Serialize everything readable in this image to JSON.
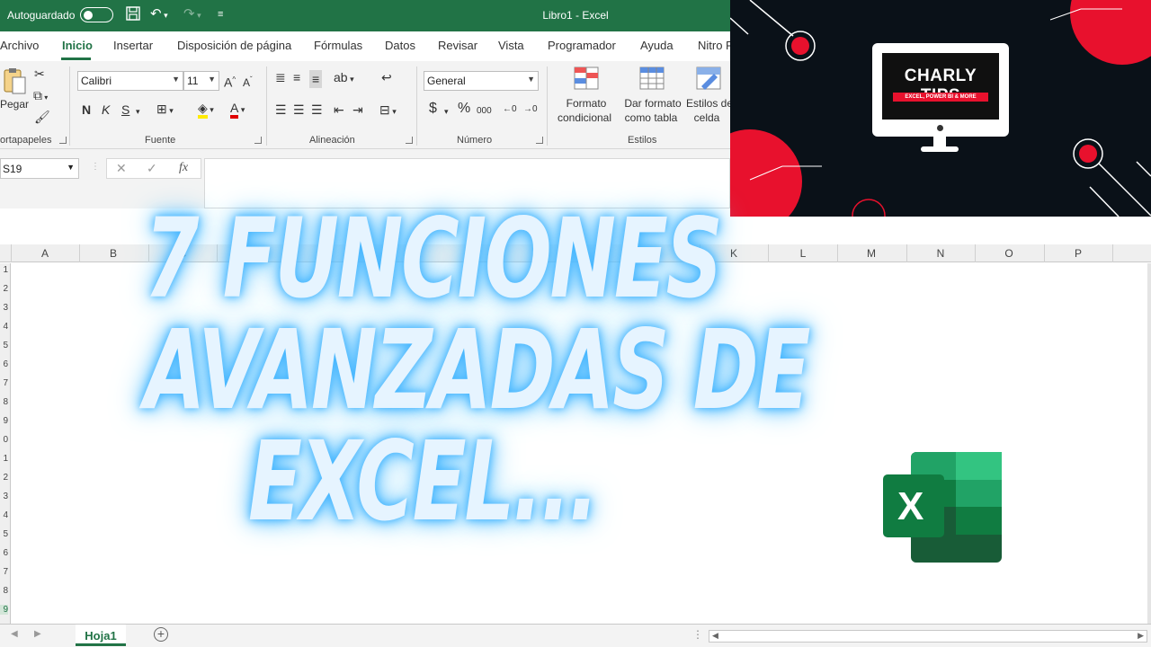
{
  "titlebar": {
    "autosave_label": "Autoguardado",
    "window_title": "Libro1  -  Excel",
    "save_icon": "save-icon",
    "undo_icon": "undo-icon",
    "redo_icon": "redo-icon",
    "customize_icon": "customize-qat-icon"
  },
  "tabs": [
    "Archivo",
    "Inicio",
    "Insertar",
    "Disposición de página",
    "Fórmulas",
    "Datos",
    "Revisar",
    "Vista",
    "Programador",
    "Ayuda",
    "Nitro P"
  ],
  "ribbon": {
    "clipboard": {
      "paste_label": "Pegar",
      "group_label": "ortapapeles"
    },
    "font": {
      "name": "Calibri",
      "size": "11",
      "bold": "N",
      "italic": "K",
      "underline": "S",
      "group_label": "Fuente"
    },
    "alignment": {
      "group_label": "Alineación"
    },
    "number": {
      "format": "General",
      "currency": "$",
      "percent": "%",
      "thousands": "000",
      "group_label": "Número"
    },
    "styles": {
      "conditional_line1": "Formato",
      "conditional_line2": "condicional",
      "table_line1": "Dar formato",
      "table_line2": "como tabla",
      "cell_line1": "Estilos de",
      "cell_line2": "celda",
      "group_label": "Estilos"
    }
  },
  "formula_bar": {
    "name_box": "S19",
    "fx": "fx"
  },
  "columns": [
    "A",
    "B",
    "C",
    "K",
    "L",
    "M",
    "N",
    "O",
    "P"
  ],
  "rows": [
    "1",
    "2",
    "3",
    "4",
    "5",
    "6",
    "7",
    "8",
    "9",
    "0",
    "1",
    "2",
    "3",
    "4",
    "5",
    "6",
    "7",
    "8",
    "9"
  ],
  "sheet": {
    "tab_name": "Hoja1"
  },
  "brand": {
    "title": "CHARLY TIPS",
    "subtitle": "EXCEL, POWER BI & MORE"
  },
  "headline": {
    "line1": "7 FUNCIONES",
    "line2": "AVANZADAS DE",
    "line3": "EXCEL..."
  },
  "logo": {
    "letter": "X"
  },
  "colors": {
    "excel_green": "#217346",
    "brand_red": "#e8112d",
    "glow_blue": "#45b6ff"
  }
}
